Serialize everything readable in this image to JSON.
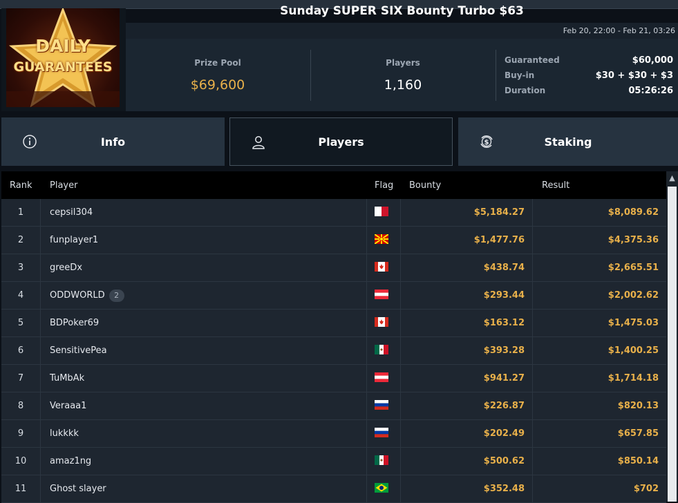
{
  "tournament": {
    "title": "Sunday SUPER SIX Bounty Turbo $63",
    "dates": "Feb 20, 22:00 - Feb 21, 03:26",
    "logo_text_1": "DAILY",
    "logo_text_2": "GUARANTEES"
  },
  "stats": {
    "prize_pool_label": "Prize Pool",
    "prize_pool_value": "$69,600",
    "players_label": "Players",
    "players_value": "1,160",
    "guaranteed_label": "Guaranteed",
    "guaranteed_value": "$60,000",
    "buyin_label": "Buy-in",
    "buyin_value": "$30 + $30 + $3",
    "duration_label": "Duration",
    "duration_value": "05:26:26"
  },
  "tabs": [
    {
      "label": "Info",
      "icon": "info-icon"
    },
    {
      "label": "Players",
      "icon": "user-icon",
      "active": true
    },
    {
      "label": "Staking",
      "icon": "dollar-cycle-icon"
    }
  ],
  "table": {
    "headers": {
      "rank": "Rank",
      "player": "Player",
      "flag": "Flag",
      "bounty": "Bounty",
      "result": "Result"
    },
    "rows": [
      {
        "rank": "1",
        "player": "cepsil304",
        "flag": "malta",
        "bounty": "$5,184.27",
        "result": "$8,089.62"
      },
      {
        "rank": "2",
        "player": "funplayer1",
        "flag": "north-macedonia",
        "bounty": "$1,477.76",
        "result": "$4,375.36"
      },
      {
        "rank": "3",
        "player": "greeDx",
        "flag": "canada",
        "bounty": "$438.74",
        "result": "$2,665.51"
      },
      {
        "rank": "4",
        "player": "ODDWORLD",
        "badge": "2",
        "flag": "austria",
        "bounty": "$293.44",
        "result": "$2,002.62"
      },
      {
        "rank": "5",
        "player": "BDPoker69",
        "flag": "canada",
        "bounty": "$163.12",
        "result": "$1,475.03"
      },
      {
        "rank": "6",
        "player": "SensitivePea",
        "flag": "mexico",
        "bounty": "$393.28",
        "result": "$1,400.25"
      },
      {
        "rank": "7",
        "player": "TuMbAk",
        "flag": "austria",
        "bounty": "$941.27",
        "result": "$1,714.18"
      },
      {
        "rank": "8",
        "player": "Veraaa1",
        "flag": "russia",
        "bounty": "$226.87",
        "result": "$820.13"
      },
      {
        "rank": "9",
        "player": "lukkkk",
        "flag": "russia",
        "bounty": "$202.49",
        "result": "$657.85"
      },
      {
        "rank": "10",
        "player": "amaz1ng",
        "flag": "mexico",
        "bounty": "$500.62",
        "result": "$850.14"
      },
      {
        "rank": "11",
        "player": "Ghost slayer",
        "flag": "brazil",
        "bounty": "$352.48",
        "result": "$702"
      }
    ]
  },
  "colors": {
    "accent": "#e8b04a",
    "panel": "#1b2631",
    "tab": "#263340"
  }
}
